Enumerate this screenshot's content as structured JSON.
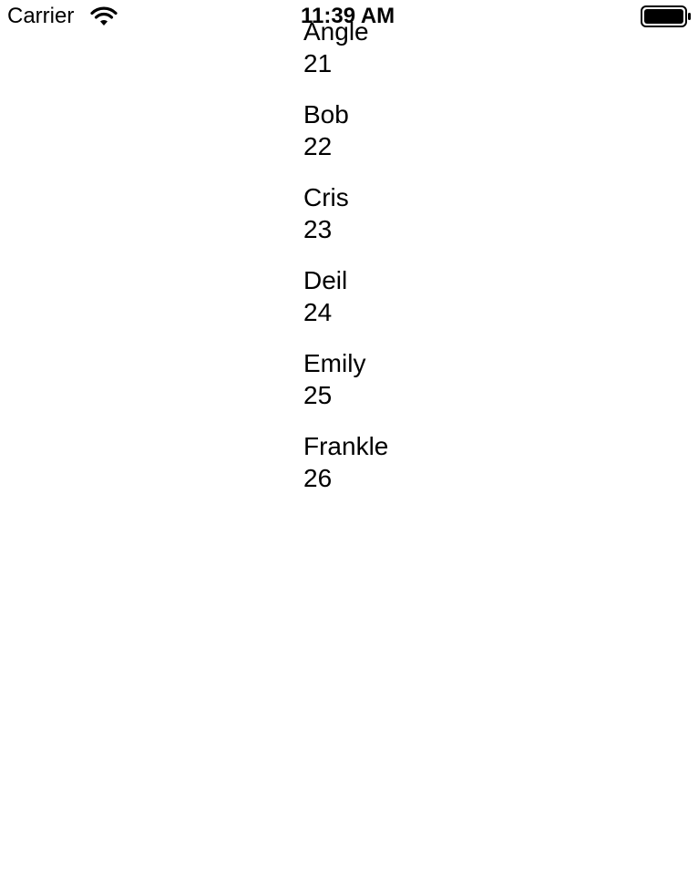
{
  "status_bar": {
    "carrier": "Carrier",
    "time": "11:39 AM",
    "icons": [
      "wifi-icon",
      "battery-icon"
    ]
  },
  "people": [
    {
      "name": "Angle",
      "age": "21"
    },
    {
      "name": "Bob",
      "age": "22"
    },
    {
      "name": "Cris",
      "age": "23"
    },
    {
      "name": "Deil",
      "age": "24"
    },
    {
      "name": "Emily",
      "age": "25"
    },
    {
      "name": "Frankle",
      "age": "26"
    }
  ],
  "colors": {
    "background": "#ffffff",
    "text": "#000000"
  }
}
